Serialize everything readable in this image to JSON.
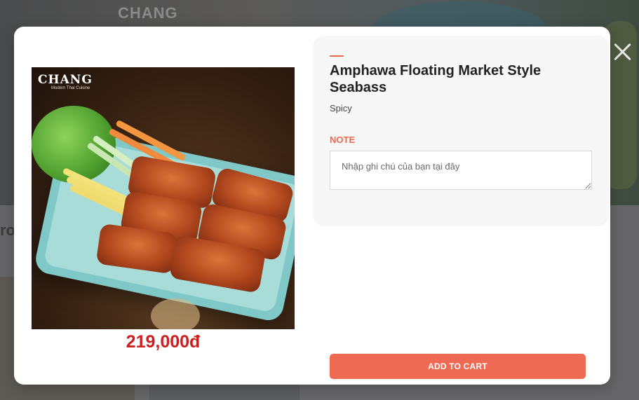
{
  "background": {
    "logo_text": "CHANG",
    "section_partial_text": "ro"
  },
  "modal": {
    "photo": {
      "logo_text": "CHANG",
      "logo_subtitle": "Modern Thai Cuisine"
    },
    "price": "219,000đ",
    "product": {
      "title": "Amphawa Floating Market Style Seabass",
      "tag": "Spicy"
    },
    "note": {
      "label": "NOTE",
      "placeholder": "Nhập ghi chú của bạn tại đây"
    },
    "add_to_cart_label": "ADD TO CART"
  },
  "colors": {
    "accent": "#ee6a52",
    "price": "#cc1f1f"
  },
  "icons": {
    "close": "close-icon"
  }
}
